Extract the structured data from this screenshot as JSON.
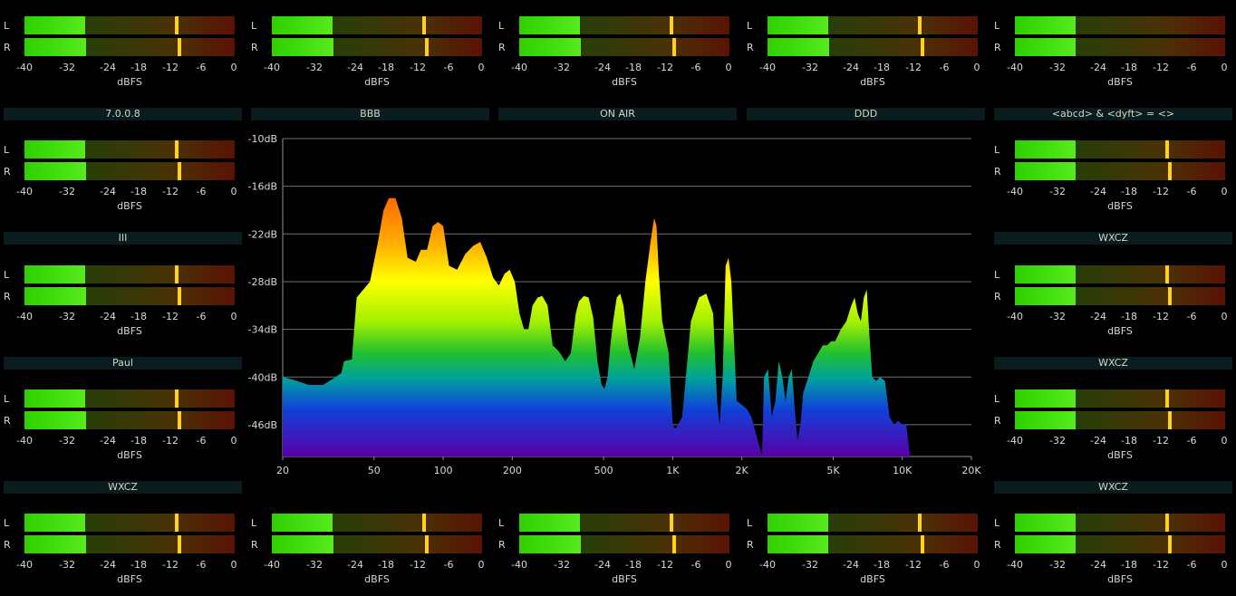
{
  "meter_scale": [
    "-40",
    "-32",
    "-24",
    "-18",
    "-12",
    "-6",
    "0"
  ],
  "meter_unit": "dBFS",
  "channels": [
    "L",
    "R"
  ],
  "labels": [
    {
      "id": "top-1",
      "text": "7.0.0.8"
    },
    {
      "id": "top-2",
      "text": "BBB"
    },
    {
      "id": "top-3",
      "text": "ON AIR"
    },
    {
      "id": "top-4",
      "text": "DDD"
    },
    {
      "id": "top-5",
      "text": "<abcd> & <dyft> = <>"
    },
    {
      "id": "left-1",
      "text": "III"
    },
    {
      "id": "right-1",
      "text": "WXCZ"
    },
    {
      "id": "left-2",
      "text": "Paul"
    },
    {
      "id": "right-2",
      "text": "WXCZ"
    },
    {
      "id": "left-3",
      "text": "WXCZ"
    },
    {
      "id": "right-3",
      "text": "WXCZ"
    }
  ],
  "meters": [
    {
      "id": "m1",
      "levels": [
        -28.5,
        -28.2
      ],
      "peaks": [
        -10.8,
        -10.2
      ]
    },
    {
      "id": "m2",
      "levels": [
        -28.5,
        -28.2
      ],
      "peaks": [
        -10.8,
        -10.2
      ]
    },
    {
      "id": "m3",
      "levels": [
        -28.5,
        -28.2
      ],
      "peaks": [
        -10.8,
        -10.2
      ]
    },
    {
      "id": "m4",
      "levels": [
        -28.5,
        -28.2
      ],
      "peaks": [
        -10.8,
        -10.2
      ]
    },
    {
      "id": "m5",
      "levels": [
        -28.5,
        -28.5
      ],
      "peaks": null
    },
    {
      "id": "m6",
      "levels": [
        -28.5,
        -28.2
      ],
      "peaks": [
        -10.8,
        -10.2
      ]
    },
    {
      "id": "m7",
      "levels": [
        -28.5,
        -28.5
      ],
      "peaks": [
        -10.8,
        -10.2
      ]
    },
    {
      "id": "m8",
      "levels": [
        -28.5,
        -28.2
      ],
      "peaks": [
        -10.8,
        -10.2
      ]
    },
    {
      "id": "m9",
      "levels": [
        -28.5,
        -28.5
      ],
      "peaks": [
        -10.8,
        -10.2
      ]
    },
    {
      "id": "m10",
      "levels": [
        -28.5,
        -28.2
      ],
      "peaks": [
        -10.8,
        -10.2
      ]
    },
    {
      "id": "m11",
      "levels": [
        -28.5,
        -28.5
      ],
      "peaks": [
        -10.8,
        -10.2
      ]
    },
    {
      "id": "m12",
      "levels": [
        -28.5,
        -28.2
      ],
      "peaks": [
        -10.8,
        -10.2
      ]
    },
    {
      "id": "m13",
      "levels": [
        -28.5,
        -28.2
      ],
      "peaks": [
        -10.8,
        -10.2
      ]
    },
    {
      "id": "m14",
      "levels": [
        -28.5,
        -28.2
      ],
      "peaks": [
        -10.8,
        -10.2
      ]
    },
    {
      "id": "m15",
      "levels": [
        -28.5,
        -28.5
      ],
      "peaks": [
        -10.8,
        -10.2
      ]
    },
    {
      "id": "m16",
      "levels": [
        -28.5,
        -28.5
      ],
      "peaks": [
        -10.8,
        -10.2
      ]
    }
  ],
  "spectrum": {
    "y_ticks": [
      "-10dB",
      "-16dB",
      "-22dB",
      "-28dB",
      "-34dB",
      "-40dB",
      "-46dB"
    ],
    "x_ticks": [
      {
        "label": "20",
        "hz": 20
      },
      {
        "label": "50",
        "hz": 50
      },
      {
        "label": "100",
        "hz": 100
      },
      {
        "label": "200",
        "hz": 200
      },
      {
        "label": "500",
        "hz": 500
      },
      {
        "label": "1K",
        "hz": 1000
      },
      {
        "label": "2K",
        "hz": 2000
      },
      {
        "label": "5K",
        "hz": 5000
      },
      {
        "label": "10K",
        "hz": 10000
      },
      {
        "label": "20K",
        "hz": 20000
      }
    ],
    "db_range": [
      -50,
      -10
    ],
    "hz_range": [
      20,
      20000
    ],
    "curve_hz": [
      20,
      22,
      26,
      30,
      34,
      36,
      37,
      40,
      42,
      48,
      52,
      55,
      58,
      62,
      66,
      70,
      76,
      80,
      85,
      90,
      95,
      100,
      106,
      115,
      125,
      135,
      145,
      155,
      165,
      175,
      185,
      195,
      205,
      215,
      225,
      235,
      245,
      258,
      270,
      285,
      300,
      320,
      340,
      360,
      378,
      390,
      410,
      430,
      450,
      470,
      490,
      505,
      520,
      535,
      550,
      570,
      590,
      610,
      640,
      680,
      720,
      760,
      800,
      830,
      850,
      870,
      900,
      930,
      960,
      1000,
      1020,
      1040,
      1100,
      1200,
      1300,
      1400,
      1500,
      1560,
      1600,
      1650,
      1700,
      1750,
      1800,
      1900,
      2000,
      2100,
      2200,
      2300,
      2400,
      2450,
      2500,
      2600,
      2700,
      2800,
      2900,
      3000,
      3100,
      3200,
      3300,
      3400,
      3500,
      3600,
      3700,
      3900,
      4100,
      4300,
      4500,
      4700,
      4900,
      5100,
      5400,
      5700,
      6000,
      6200,
      6400,
      6600,
      6800,
      7000,
      7200,
      7400,
      7700,
      8000,
      8400,
      8800,
      9200,
      9600,
      10000,
      10400,
      10800,
      11200,
      11600,
      12000
    ],
    "curve_db": [
      -40,
      -40.3,
      -41,
      -41,
      -40,
      -39.5,
      -38,
      -37.8,
      -30,
      -28,
      -23,
      -19,
      -17.5,
      -17.5,
      -20,
      -25,
      -25.5,
      -24,
      -24,
      -21,
      -20.5,
      -21,
      -26,
      -26.5,
      -24.5,
      -23.5,
      -23,
      -25,
      -27.5,
      -28.5,
      -27,
      -26.5,
      -28,
      -32,
      -34,
      -34,
      -31,
      -30,
      -29.8,
      -31,
      -36,
      -36.8,
      -38,
      -37,
      -32,
      -30.5,
      -29.8,
      -30,
      -32.5,
      -38,
      -41,
      -41.5,
      -40,
      -36,
      -33,
      -30,
      -29.5,
      -31,
      -36,
      -39,
      -35,
      -28,
      -23,
      -20,
      -21,
      -27,
      -33,
      -35,
      -37,
      -46,
      -46.5,
      -46.3,
      -45,
      -33,
      -30,
      -29.5,
      -32,
      -43,
      -46,
      -40,
      -26,
      -25,
      -28,
      -43,
      -43.5,
      -44,
      -45,
      -47,
      -49,
      -50,
      -40,
      -39,
      -45,
      -43,
      -38,
      -40,
      -43,
      -40,
      -39,
      -44,
      -48,
      -46,
      -42,
      -40,
      -38,
      -37,
      -36,
      -36,
      -35.5,
      -35.5,
      -34,
      -33,
      -31,
      -30,
      -32,
      -33,
      -30,
      -29,
      -35,
      -40,
      -40.5,
      -40,
      -40.5,
      -45,
      -46,
      -45.5,
      -46,
      -46,
      -50,
      -50
    ]
  }
}
